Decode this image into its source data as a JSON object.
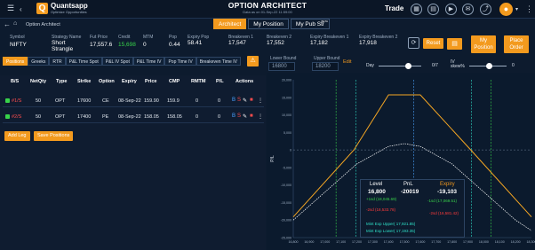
{
  "topbar": {
    "brand": "Quantsapp",
    "brand_tagline": "Optimize Opportunities",
    "title": "OPTION ARCHITECT",
    "subtitle": "Data as on 01-Sep-22 11:59:00",
    "trade_label": "Trade"
  },
  "nav": {
    "breadcrumb": "Option Architect",
    "tabs": [
      "Architect",
      "My Position",
      "My Pub Str"
    ],
    "badge": "BETA"
  },
  "info": {
    "symbol": {
      "label": "Symbol",
      "value": "NIFTY"
    },
    "strategy": {
      "label": "Strategy Name",
      "value": "Short Strangle"
    },
    "fut_price": {
      "label": "Fut Price",
      "value": "17,557.6"
    },
    "credit": {
      "label": "Credit",
      "value": "15,698"
    },
    "mtm": {
      "label": "MTM",
      "value": "0"
    },
    "pop": {
      "label": "Pop",
      "value": "0.44"
    },
    "expiry_pop": {
      "label": "Expiry Pop",
      "value": "58.41"
    },
    "breakeven1": {
      "label": "Breakeven 1",
      "value": "17,547"
    },
    "breakeven2": {
      "label": "Breakeven 2",
      "value": "17,552"
    },
    "expiry_breakeven1": {
      "label": "Expiry Breakeven 1",
      "value": "17,182"
    },
    "expiry_breakeven2": {
      "label": "Expiry Breakeven 2",
      "value": "17,918"
    }
  },
  "buttons": {
    "reset": "Reset",
    "my_position": "My Position",
    "place_order": "Place Order",
    "add_leg": "Add Leg",
    "save_positions": "Save Positions",
    "edit": "Edit"
  },
  "subtabs": [
    "Positions",
    "Greeks",
    "RTR",
    "P&L Time Spot",
    "P&L IV Spot",
    "P&L Time IV",
    "Pop Time IV",
    "Breakeven Time IV"
  ],
  "bounds": {
    "lower_label": "Lower Bound",
    "lower_value": "16800",
    "upper_label": "Upper Bound",
    "upper_value": "18200",
    "day_label": "Day",
    "day_value": "0/7",
    "iv_label": "IV skew%",
    "iv_value": "0"
  },
  "table": {
    "headers": [
      "B/S",
      "NetQty",
      "Type",
      "Strike",
      "Option",
      "Expiry",
      "Price",
      "CMP",
      "RMTM",
      "P/L",
      "Actions"
    ],
    "rows": [
      {
        "bs": "#1/S",
        "qty": "50",
        "type": "OPT",
        "strike": "17600",
        "option": "CE",
        "expiry": "08-Sep-22",
        "price": "159.90",
        "cmp": "159.9",
        "rmtm": "0",
        "pl": "0"
      },
      {
        "bs": "#2/S",
        "qty": "50",
        "type": "OPT",
        "strike": "17400",
        "option": "PE",
        "expiry": "08-Sep-22",
        "price": "158.05",
        "cmp": "158.05",
        "rmtm": "0",
        "pl": "0"
      }
    ]
  },
  "tooltip": {
    "level_label": "Level",
    "level_value": "16,800",
    "pnl_label": "PnL",
    "pnl_value": "-20019",
    "expiry_label": "Expiry",
    "expiry_value": "-19,103",
    "plus1sd": "+1sd (18,045.69)",
    "minus1sd_left": "-1sd (17,069.51)",
    "plus2sd": "-2sd (18,533.78)",
    "minus2sd_left": "-2sd (16,581.42)",
    "mint_upper": "Mint Exp Upper( 17,921.85)",
    "mint_lower": "Mint Exp Lower( 17,193.35)"
  },
  "chart_data": {
    "type": "line",
    "ylabel": "P/L",
    "xlim": [
      16800,
      18300
    ],
    "ylim": [
      -25000,
      20000
    ],
    "x_ticks": [
      16800,
      16900,
      17000,
      17100,
      17200,
      17300,
      17400,
      17500,
      17600,
      17700,
      17800,
      17900,
      18000,
      18100,
      18200,
      18300
    ],
    "y_ticks": [
      20000,
      15000,
      10000,
      5000,
      0,
      -5000,
      -10000,
      -15000,
      -20000,
      -25000
    ],
    "series": [
      {
        "x": [
          16800,
          17182,
          17400,
          17600,
          17918,
          18300
        ],
        "values": [
          -19103,
          0,
          15698,
          15698,
          0,
          -19103
        ],
        "color": "#f5a623"
      },
      {
        "x": [
          16800,
          17000,
          17200,
          17400,
          17500,
          17600,
          17800,
          18000,
          18200,
          18300
        ],
        "values": [
          -20019,
          -12000,
          -4000,
          1000,
          1800,
          1000,
          -4000,
          -12000,
          -20019,
          -23000
        ],
        "color": "#ffffff"
      }
    ],
    "vlines": [
      {
        "x": 17069.51,
        "color": "#38d24a"
      },
      {
        "x": 18045.69,
        "color": "#38d24a"
      },
      {
        "x": 16581.42,
        "color": "#ff3b3b"
      },
      {
        "x": 18533.78,
        "color": "#ff3b3b"
      },
      {
        "x": 17193.35,
        "color": "#2fe0c8"
      },
      {
        "x": 17921.85,
        "color": "#2fe0c8"
      },
      {
        "x": 17557.6,
        "color": "#4aa3ff"
      }
    ]
  }
}
